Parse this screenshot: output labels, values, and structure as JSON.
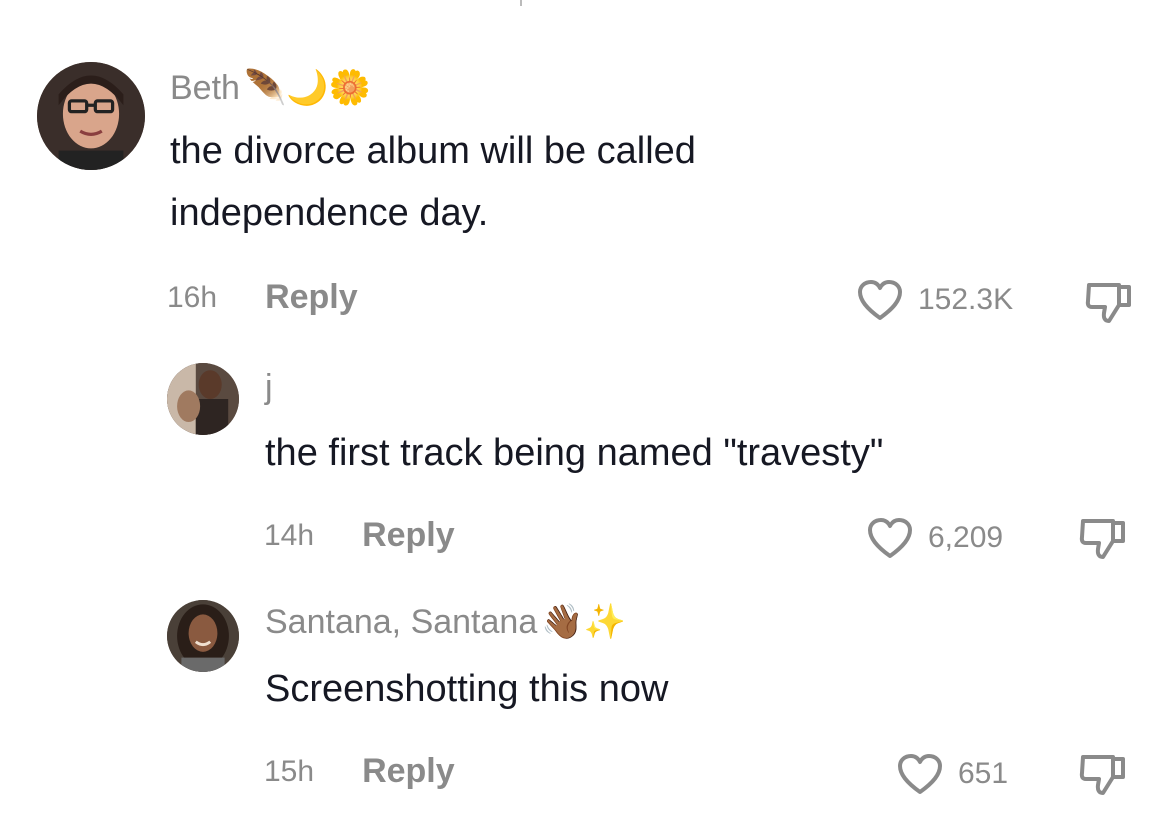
{
  "comments": [
    {
      "username": "Beth",
      "emojis": "🪶🌙🌼",
      "text": "the divorce album will be called independence day.",
      "time": "16h",
      "reply_label": "Reply",
      "likes": "152.3K"
    },
    {
      "username": "j",
      "emojis": "",
      "text": "the first track being named \"travesty\"",
      "time": "14h",
      "reply_label": "Reply",
      "likes": "6,209"
    },
    {
      "username": "Santana, Santana",
      "emojis": "👋🏾✨",
      "text": "Screenshotting this now",
      "time": "15h",
      "reply_label": "Reply",
      "likes": "651"
    }
  ],
  "icons": {
    "like": "heart-outline-icon",
    "dislike": "thumbs-down-icon"
  },
  "colors": {
    "text": "#161823",
    "muted": "#8a8a8a",
    "background": "#ffffff"
  }
}
